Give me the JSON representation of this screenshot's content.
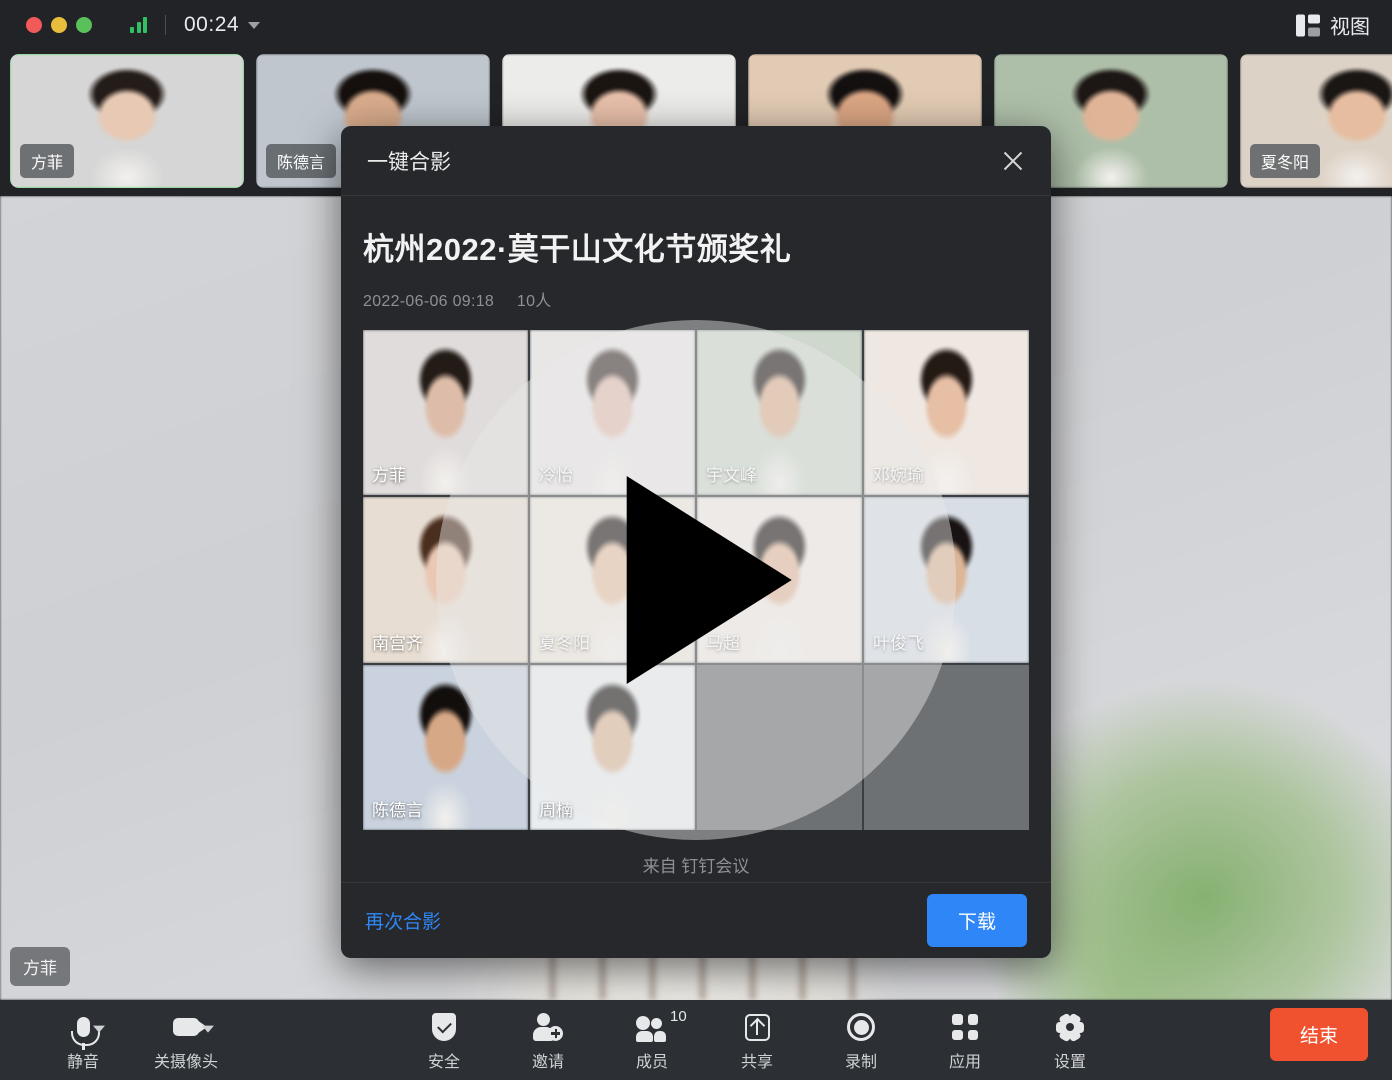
{
  "titlebar": {
    "timer": "00:24",
    "view_label": "视图",
    "signal_icon": "signal-bars-icon",
    "caret_icon": "chevron-down-icon"
  },
  "filmstrip": {
    "tiles": [
      {
        "name": "方菲",
        "active": true,
        "bg": "#d6d6d6",
        "skin": "#e7c9b4",
        "hair": "#241c18"
      },
      {
        "name": "陈德言",
        "active": false,
        "bg": "#bfc6ce",
        "skin": "#d9ac8c",
        "hair": "#15100d"
      },
      {
        "name": "",
        "active": false,
        "bg": "#ececea",
        "skin": "#e8c0ab",
        "hair": "#1b1512"
      },
      {
        "name": "",
        "active": false,
        "bg": "#e2cbb4",
        "skin": "#dba684",
        "hair": "#141010"
      },
      {
        "name": "",
        "active": false,
        "bg": "#aebfa9",
        "skin": "#e0b597",
        "hair": "#1c1614"
      },
      {
        "name": "夏冬阳",
        "active": false,
        "bg": "#ddd2c6",
        "skin": "#e6bda0",
        "hair": "#1a1614"
      }
    ]
  },
  "stage": {
    "self_name": "方菲"
  },
  "modal": {
    "header_title": "一键合影",
    "close_icon": "close-icon",
    "composition_title": "杭州2022·莫干山文化节颁奖礼",
    "date": "2022-06-06 09:18",
    "participant_count": "10人",
    "play_icon": "play-triangle-icon",
    "from_label": "来自 钉钉会议",
    "again_link": "再次合影",
    "download_button": "下载",
    "accent_blue": "#2f87f7",
    "grid": [
      {
        "name": "方菲",
        "bg": "#e0dcdb",
        "skin": "#ddbda9",
        "hair": "#231b16"
      },
      {
        "name": "冷怡",
        "bg": "#e9e6e6",
        "skin": "#e2c0b1",
        "hair": "#3a2e2b"
      },
      {
        "name": "宇文峰",
        "bg": "#ced8cd",
        "skin": "#dcb293",
        "hair": "#1e1715"
      },
      {
        "name": "邓婉瑜",
        "bg": "#efe8e2",
        "skin": "#e6bfa5",
        "hair": "#241a14"
      },
      {
        "name": "南宫齐",
        "bg": "#e7ddd2",
        "skin": "#eac8b4",
        "hair": "#4a2e1e"
      },
      {
        "name": "夏冬阳",
        "bg": "#efe8e0",
        "skin": "#e8c3a6",
        "hair": "#1d1715"
      },
      {
        "name": "马超",
        "bg": "#f2ece8",
        "skin": "#e3bb9e",
        "hair": "#1a1413"
      },
      {
        "name": "叶俊飞",
        "bg": "#d8dee6",
        "skin": "#ddb697",
        "hair": "#181312"
      },
      {
        "name": "陈德言",
        "bg": "#c9d2de",
        "skin": "#d7a886",
        "hair": "#120e0c"
      },
      {
        "name": "周楠",
        "bg": "#e9edf0",
        "skin": "#ddb89a",
        "hair": "#14100f"
      },
      {
        "name": "",
        "bg": "#6e7174",
        "skin": "",
        "hair": ""
      },
      {
        "name": "",
        "bg": "#6e7174",
        "skin": "",
        "hair": ""
      }
    ]
  },
  "toolbar": {
    "items": [
      {
        "label": "静音",
        "icon": "microphone-icon",
        "caret": true,
        "badge": ""
      },
      {
        "label": "关摄像头",
        "icon": "camera-icon",
        "caret": true,
        "badge": ""
      },
      {
        "label": "安全",
        "icon": "shield-icon",
        "caret": false,
        "badge": ""
      },
      {
        "label": "邀请",
        "icon": "add-person-icon",
        "caret": false,
        "badge": ""
      },
      {
        "label": "成员",
        "icon": "people-icon",
        "caret": false,
        "badge": "10"
      },
      {
        "label": "共享",
        "icon": "share-upload-icon",
        "caret": false,
        "badge": ""
      },
      {
        "label": "录制",
        "icon": "record-icon",
        "caret": false,
        "badge": ""
      },
      {
        "label": "应用",
        "icon": "apps-grid-icon",
        "caret": false,
        "badge": ""
      },
      {
        "label": "设置",
        "icon": "gear-icon",
        "caret": false,
        "badge": ""
      }
    ],
    "end_button": "结束",
    "end_color": "#f0522f"
  }
}
